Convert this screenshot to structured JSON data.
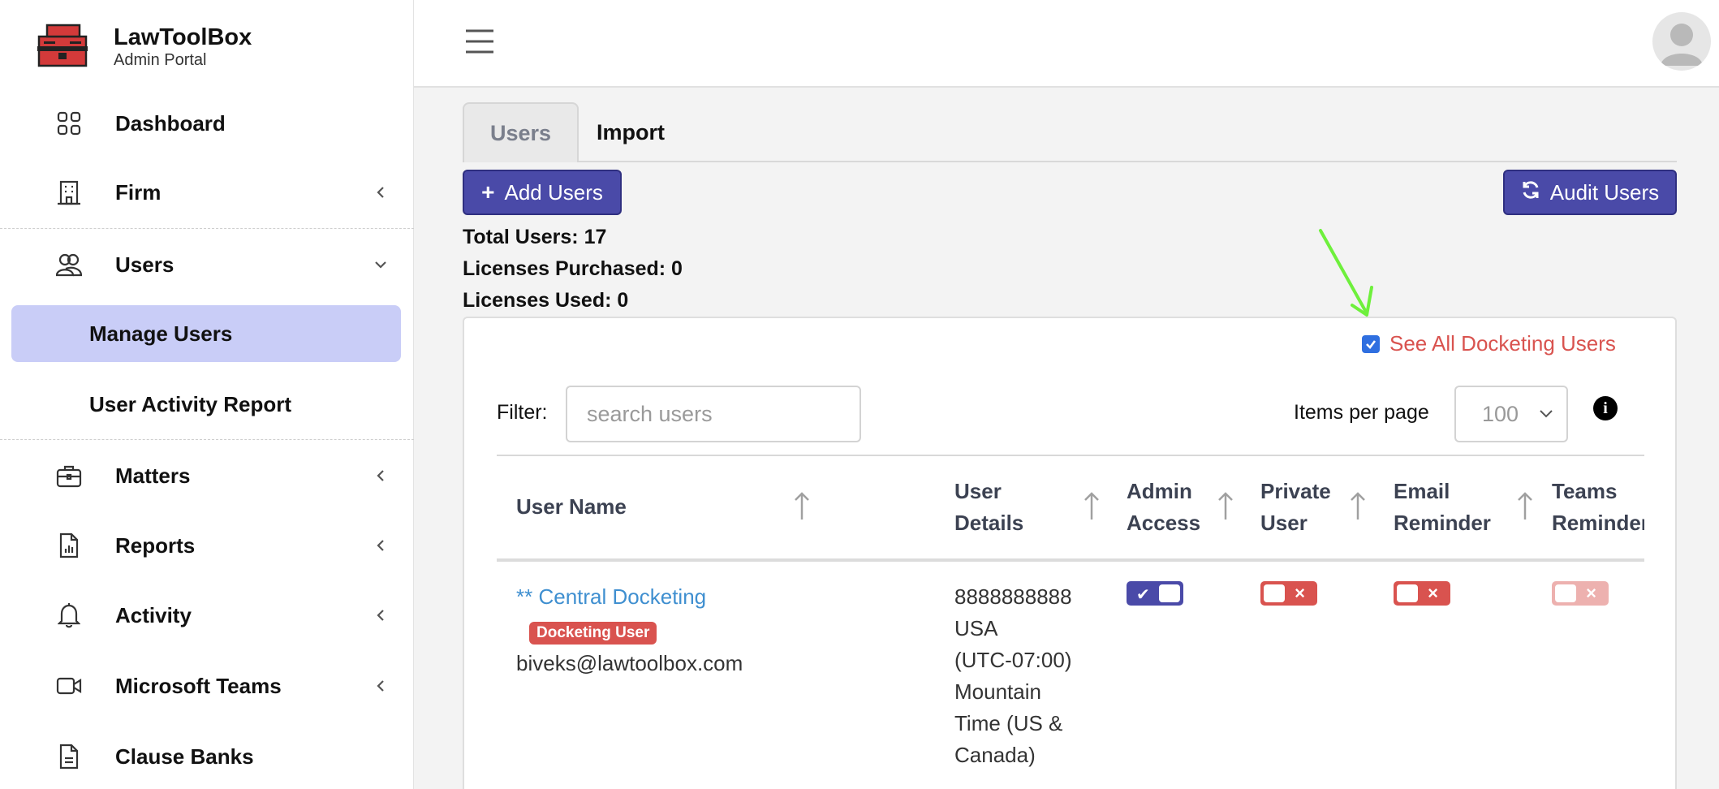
{
  "brand": {
    "title": "LawToolBox",
    "subtitle": "Admin Portal"
  },
  "sidebar": {
    "items": [
      {
        "label": "Dashboard",
        "icon": "grid-icon"
      },
      {
        "label": "Firm",
        "icon": "building-icon"
      },
      {
        "label": "Users",
        "icon": "users-icon"
      },
      {
        "label": "Manage Users"
      },
      {
        "label": "User Activity Report"
      },
      {
        "label": "Matters",
        "icon": "briefcase-icon"
      },
      {
        "label": "Reports",
        "icon": "report-icon"
      },
      {
        "label": "Activity",
        "icon": "bell-icon"
      },
      {
        "label": "Microsoft Teams",
        "icon": "video-icon"
      },
      {
        "label": "Clause Banks",
        "icon": "document-icon"
      }
    ]
  },
  "tabs": {
    "users": "Users",
    "import": "Import"
  },
  "toolbar": {
    "add_users": "Add Users",
    "audit_users": "Audit Users"
  },
  "stats": {
    "total_users": "Total Users: 17",
    "licenses_purchased": "Licenses Purchased: 0",
    "licenses_used": "Licenses Used: 0"
  },
  "see_all": {
    "label": "See All Docketing Users",
    "checked": true
  },
  "filter": {
    "label": "Filter:",
    "placeholder": "search users"
  },
  "items_per_page": {
    "label": "Items per page",
    "value": "100"
  },
  "table": {
    "headers": {
      "user_name": "User Name",
      "user_details_1": "User",
      "user_details_2": "Details",
      "admin_access_1": "Admin",
      "admin_access_2": "Access",
      "private_user_1": "Private",
      "private_user_2": "User",
      "email_reminder_1": "Email",
      "email_reminder_2": "Reminder",
      "teams_reminder_1": "Teams",
      "teams_reminder_2": "Reminder"
    },
    "rows": [
      {
        "name": "** Central Docketing",
        "badge": "Docketing User",
        "email": "biveks@lawtoolbox.com",
        "details": [
          "8888888888",
          "USA",
          "(UTC-07:00)",
          "Mountain",
          "Time (US &",
          "Canada)"
        ],
        "admin_access": true,
        "private_user": false,
        "email_reminder": false,
        "teams_reminder": false
      }
    ]
  },
  "colors": {
    "primary": "#4a4aa8",
    "danger": "#d9534f",
    "active_nav": "#c9cdf7",
    "link": "#3f8fd0",
    "annotation_arrow": "#6ef03c"
  }
}
